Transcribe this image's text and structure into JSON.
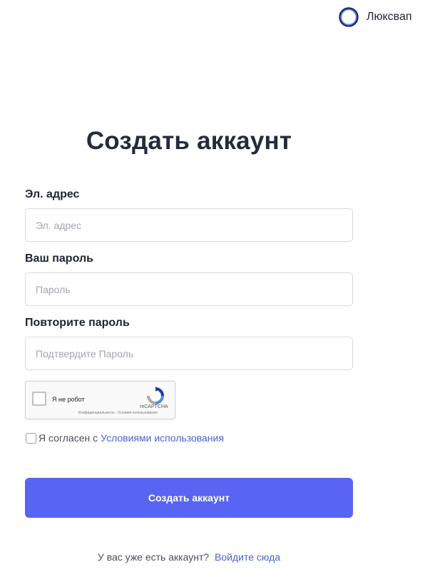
{
  "brand": {
    "name": "Люксвап",
    "logo_color": "#4b5fd6"
  },
  "page": {
    "title": "Создать аккаунт"
  },
  "form": {
    "email": {
      "label": "Эл. адрес",
      "value": "",
      "placeholder": "Эл. адрес"
    },
    "password": {
      "label": "Ваш пароль",
      "value": "",
      "placeholder": "Пароль"
    },
    "password_confirm": {
      "label": "Повторите пароль",
      "value": "",
      "placeholder": "Подтвердите Пароль"
    },
    "recaptcha": {
      "label": "Я не робот",
      "brand": "reCAPTCHA",
      "links": "Конфиденциальность - Условия использования",
      "checked": false
    },
    "terms": {
      "text": "Я согласен с",
      "link_text": "Условиями использования",
      "checked": false
    },
    "submit_label": "Создать аккаунт"
  },
  "login": {
    "text": "У вас уже есть аккаунт?",
    "link_text": "Войдите сюда"
  },
  "colors": {
    "accent": "#5865f2",
    "link": "#4a63d6"
  }
}
